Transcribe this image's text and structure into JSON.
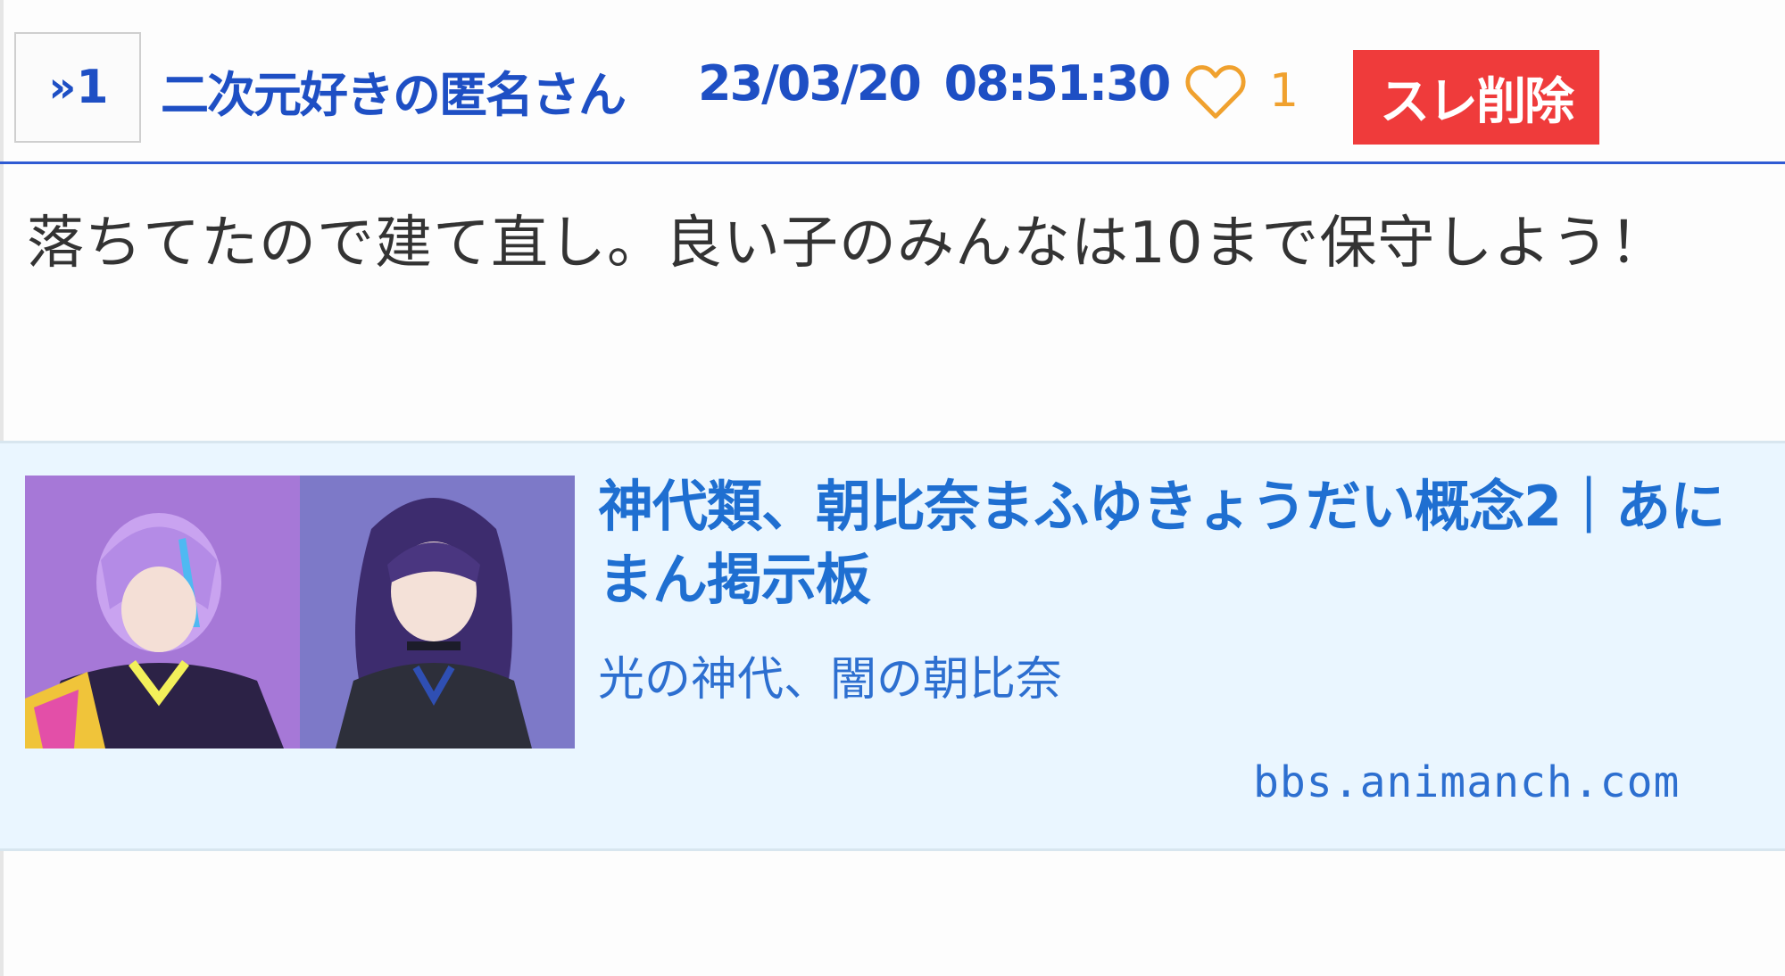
{
  "post": {
    "reply_label": "1",
    "author": "二次元好きの匿名さん",
    "timestamp": "23/03/20 08:51:30",
    "like_count": "1",
    "delete_label": "スレ削除",
    "body": "落ちてたので建て直し。良い子のみんなは10まで保守しよう！"
  },
  "link_card": {
    "title": "神代類、朝比奈まふゆきょうだい概念2｜あにまん掲示板",
    "description": "光の神代、闇の朝比奈",
    "domain": "bbs.animanch.com"
  },
  "colors": {
    "accent_blue": "#1e4fc4",
    "like_orange": "#f0a12e",
    "delete_red": "#ef3b3b",
    "card_bg": "#eaf6ff"
  },
  "icons": {
    "reply": "double-chevron-right-icon",
    "like": "heart-outline-icon"
  }
}
